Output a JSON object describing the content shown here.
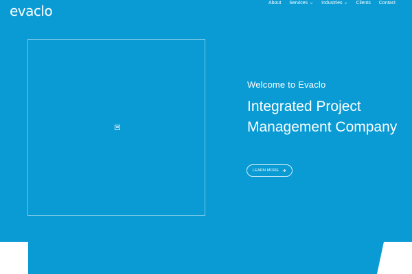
{
  "brand": {
    "logo_text": "evaclo"
  },
  "nav": {
    "items": [
      {
        "label": "About",
        "has_dropdown": false
      },
      {
        "label": "Services",
        "has_dropdown": true
      },
      {
        "label": "Industries",
        "has_dropdown": true
      },
      {
        "label": "Clients",
        "has_dropdown": false
      },
      {
        "label": "Contact",
        "has_dropdown": false
      }
    ]
  },
  "hero": {
    "subtitle": "Welcome to Evaclo",
    "title": "Integrated Project Management Company",
    "cta_label": "LEARN MORE"
  },
  "colors": {
    "hero_background": "#0a9bd4",
    "text": "#ffffff",
    "page_background": "#ffffff"
  },
  "icons": {
    "media_placeholder": "broken-image-icon",
    "cta_arrow": "arrow-right-icon",
    "dropdown": "chevron-down-icon"
  }
}
